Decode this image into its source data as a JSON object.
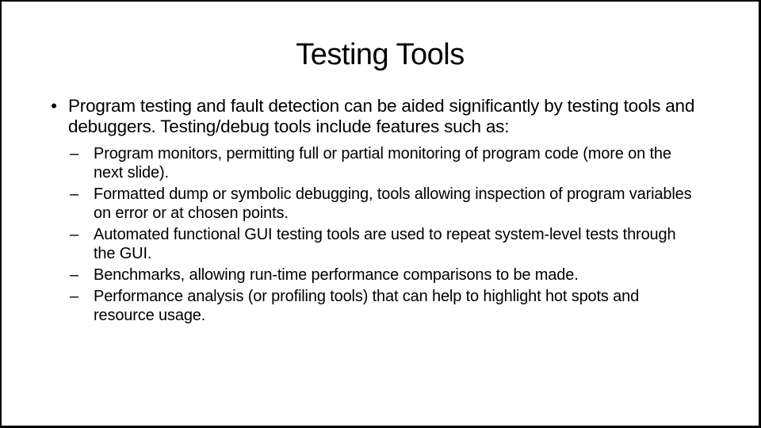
{
  "slide": {
    "title": "Testing Tools",
    "bullets": [
      {
        "marker": "•",
        "text": "Program testing and fault detection can be aided significantly by testing tools and debuggers. Testing/debug tools include features such as:",
        "sub_bullets": [
          {
            "marker": "–",
            "text": "Program monitors, permitting full or partial monitoring of program code (more on the next slide)."
          },
          {
            "marker": "–",
            "text": "Formatted dump or symbolic debugging, tools allowing inspection of program variables on error or at chosen points."
          },
          {
            "marker": "–",
            "text": "Automated functional GUI testing tools are used to repeat system-level tests through the GUI."
          },
          {
            "marker": "–",
            "text": "Benchmarks, allowing run-time performance comparisons to be made."
          },
          {
            "marker": "–",
            "text": "Performance analysis (or profiling tools) that can help to highlight hot spots and resource usage."
          }
        ]
      }
    ]
  },
  "colors": {
    "background": "#ffffff",
    "text": "#000000",
    "border": "#000000"
  }
}
